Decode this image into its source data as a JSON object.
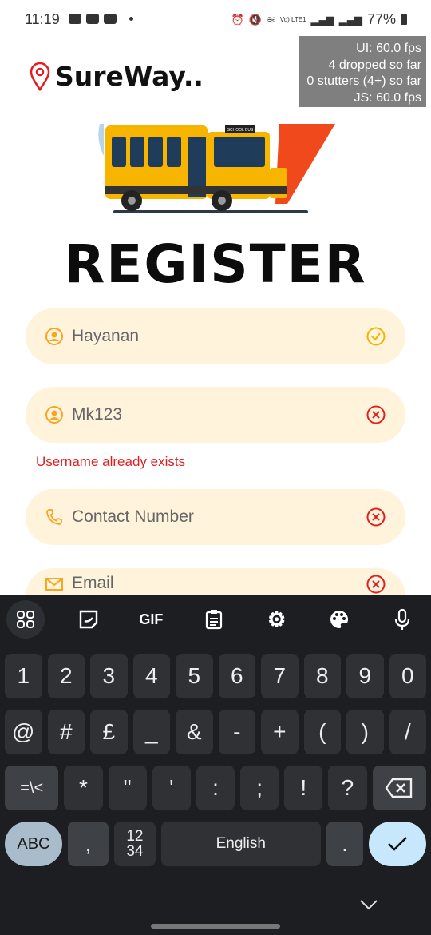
{
  "status": {
    "time": "11:19",
    "battery": "77%",
    "network": "Vo) LTE1"
  },
  "fps": {
    "ui": "UI: 60.0 fps",
    "dropped": "4 dropped so far",
    "stutters": "0 stutters (4+) so far",
    "js": "JS: 60.0 fps"
  },
  "app": {
    "brand": "SureWay..",
    "title": "REGISTER",
    "bus_label": "SCHOOL BUS"
  },
  "form": {
    "name": {
      "value": "Hayanan",
      "status": "valid"
    },
    "username": {
      "value": "Mk123",
      "status": "invalid",
      "error": "Username already exists"
    },
    "contact": {
      "placeholder": "Contact Number",
      "status": "invalid"
    },
    "email": {
      "placeholder": "Email",
      "status": "invalid"
    }
  },
  "colors": {
    "accent": "#f5a623",
    "field_bg": "#fff3dc",
    "error": "#e02020",
    "valid": "#f0b400"
  },
  "keyboard": {
    "toolbar": {
      "gif": "GIF"
    },
    "row1": [
      "1",
      "2",
      "3",
      "4",
      "5",
      "6",
      "7",
      "8",
      "9",
      "0"
    ],
    "row2": [
      "@",
      "#",
      "£",
      "_",
      "&",
      "-",
      "+",
      "(",
      ")",
      "/"
    ],
    "row3": [
      "=\\<",
      "*",
      "\"",
      "'",
      ":",
      ";",
      "!",
      "?"
    ],
    "abc": "ABC",
    "comma": ",",
    "numpad_top": "12",
    "numpad_bottom": "34",
    "space": "English",
    "period": "."
  }
}
